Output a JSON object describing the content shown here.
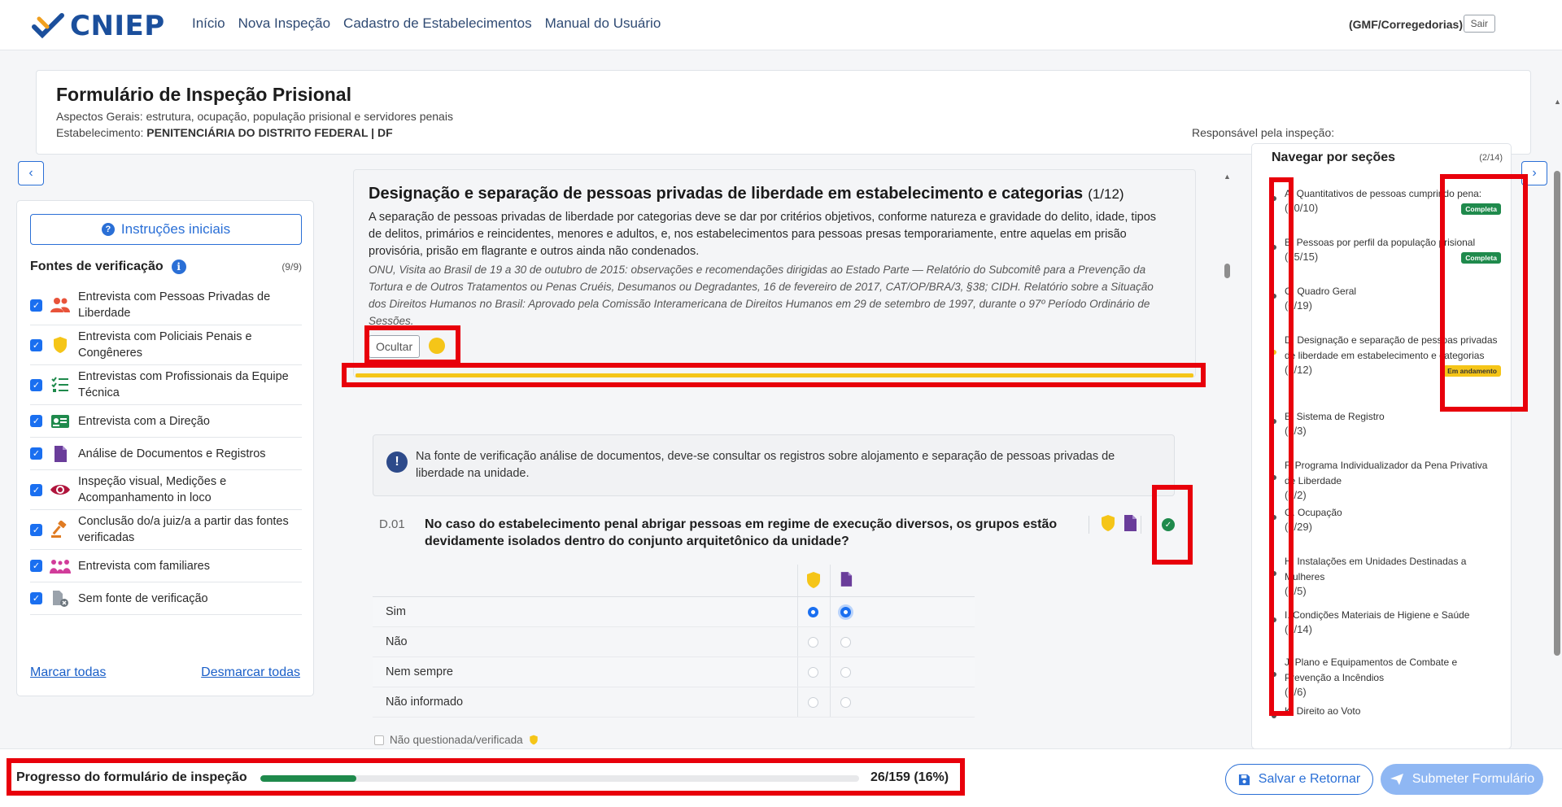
{
  "app": {
    "logo_text": "CNIEP",
    "nav": [
      "Início",
      "Nova Inspeção",
      "Cadastro de Estabelecimentos",
      "Manual do Usuário"
    ],
    "user": "(GMF/Corregedorias)",
    "logout": "Sair"
  },
  "header": {
    "title": "Formulário de Inspeção Prisional",
    "subtitle": "Aspectos Gerais: estrutura, ocupação, população prisional e servidores penais",
    "est_label": "Estabelecimento:",
    "est_value": "PENITENCIÁRIA DO DISTRITO FEDERAL | DF",
    "responsavel": "Responsável pela inspeção:"
  },
  "left": {
    "instr_button": "Instruções iniciais",
    "fontes_title": "Fontes de verificação",
    "fontes_count": "(9/9)",
    "sources": [
      {
        "label": "Entrevista com Pessoas Privadas de Liberdade",
        "icon": "people-icon",
        "color": "#e8533a"
      },
      {
        "label": "Entrevista com Policiais Penais e Congêneres",
        "icon": "shield-icon",
        "color": "#f5c518"
      },
      {
        "label": "Entrevistas com Profissionais da Equipe Técnica",
        "icon": "checklist-icon",
        "color": "#1f8a4c"
      },
      {
        "label": "Entrevista com a Direção",
        "icon": "id-card-icon",
        "color": "#1f8a4c"
      },
      {
        "label": "Análise de Documentos e Registros",
        "icon": "document-icon",
        "color": "#6a3d9a"
      },
      {
        "label": "Inspeção visual, Medições e Acompanhamento in loco",
        "icon": "eye-icon",
        "color": "#b0143c"
      },
      {
        "label": "Conclusão do/a juiz/a a partir das fontes verificadas",
        "icon": "gavel-icon",
        "color": "#e07b22"
      },
      {
        "label": "Entrevista com familiares",
        "icon": "family-icon",
        "color": "#d13c9a"
      },
      {
        "label": "Sem fonte de verificação",
        "icon": "no-source-icon",
        "color": "#9aa2ab"
      }
    ],
    "marcar": "Marcar todas",
    "desmarcar": "Desmarcar todas"
  },
  "section": {
    "title": "Designação e separação de pessoas privadas de liberdade em estabelecimento e categorias",
    "count": "(1/12)",
    "description": "A separação de pessoas privadas de liberdade por categorias deve se dar por critérios objetivos, conforme natureza e gravidade do delito, idade, tipos de delitos, primários e reincidentes, menores e adultos, e, nos estabelecimentos para pessoas presas temporariamente, entre aquelas em prisão provisória, prisão em flagrante e outros ainda não condenados.",
    "reference": "ONU, Visita ao Brasil de 19 a 30 de outubro de 2015: observações e recomendações dirigidas ao Estado Parte — Relatório do Subcomitê para a Prevenção da Tortura e de Outros Tratamentos ou Penas Cruéis, Desumanos ou Degradantes, 16 de fevereiro de 2017, CAT/OP/BRA/3, §38; CIDH. Relatório sobre a Situação dos Direitos Humanos no Brasil: Aprovado pela Comissão Interamericana de Direitos Humanos em 29 de setembro de 1997, durante o 97º Período Ordinário de Sessões.",
    "hide_button": "Ocultar"
  },
  "alert": {
    "text": "Na fonte de verificação análise de documentos, deve-se consultar os registros sobre alojamento e separação de pessoas privadas de liberdade na unidade."
  },
  "question": {
    "code": "D.01",
    "text": "No caso do estabelecimento penal abrigar pessoas em regime de execução diversos, os grupos estão devidamente isolados dentro do conjunto arquitetônico da unidade?",
    "answers": [
      "Sim",
      "Não",
      "Nem sempre",
      "Não informado"
    ],
    "not_questioned": "Não questionada/verificada"
  },
  "sections_nav": {
    "title": "Navegar por seções",
    "count": "(2/14)",
    "items": [
      {
        "name": "A. Quantitativos de pessoas cumprindo pena:",
        "count": "(10/10)",
        "badge": "Completa",
        "status": "done"
      },
      {
        "name": "B. Pessoas por perfil da população prisional",
        "count": "(15/15)",
        "badge": "Completa",
        "status": "done"
      },
      {
        "name": "C. Quadro Geral",
        "count": "(0/19)",
        "badge": "",
        "status": "none"
      },
      {
        "name": "D. Designação e separação de pessoas privadas de liberdade em estabelecimento e categorias",
        "count": "(1/12)",
        "badge": "Em andamento",
        "status": "progress"
      },
      {
        "name": "E. Sistema de Registro",
        "count": "(0/3)",
        "badge": "",
        "status": "none"
      },
      {
        "name": "F. Programa Individualizador da Pena Privativa de Liberdade",
        "count": "(0/2)",
        "badge": "",
        "status": "none"
      },
      {
        "name": "G. Ocupação",
        "count": "(0/29)",
        "badge": "",
        "status": "none"
      },
      {
        "name": "H. Instalações em Unidades Destinadas a Mulheres",
        "count": "(0/5)",
        "badge": "",
        "status": "none"
      },
      {
        "name": "I. Condições Materiais de Higiene e Saúde",
        "count": "(0/14)",
        "badge": "",
        "status": "none"
      },
      {
        "name": "J. Plano e Equipamentos de Combate e Prevenção a Incêndios",
        "count": "(0/6)",
        "badge": "",
        "status": "none"
      },
      {
        "name": "K. Direito ao Voto",
        "count": "",
        "badge": "",
        "status": "none"
      }
    ]
  },
  "progress": {
    "label": "Progresso do formulário de inspeção",
    "value": 0.16,
    "text": "26/159 (16%)"
  },
  "actions": {
    "save": "Salvar e Retornar",
    "submit": "Submeter Formulário"
  },
  "colors": {
    "primary": "#2a6fd6",
    "success": "#1f8a4c",
    "warning": "#f5c518",
    "annotation": "#e8000b"
  }
}
